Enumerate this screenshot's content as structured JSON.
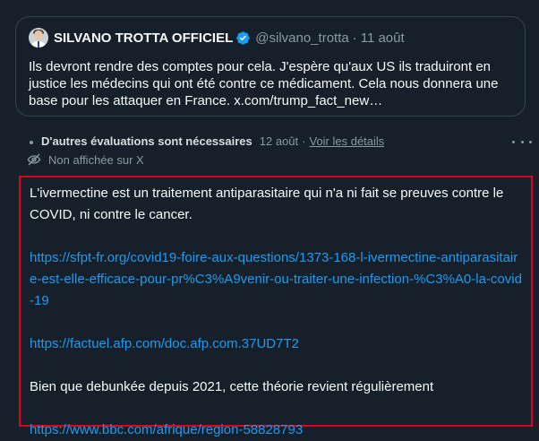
{
  "quoted_tweet": {
    "author_name": "SILVANO TROTTA OFFICIEL",
    "handle": "@silvano_trotta",
    "separator": "·",
    "date": "11 août",
    "text": "Ils devront rendre des comptes pour cela. J'espère qu'aux US ils traduiront en justice les médecins qui ont été contre ce médicament. Cela nous donnera une base pour les attaquer en France. x.com/trump_fact_new…",
    "verified_icon": "verified-badge-icon"
  },
  "community_note": {
    "rating_status": "D'autres évaluations sont nécessaires",
    "date": "12 août",
    "separator": "·",
    "details_link": "Voir les détails",
    "more_icon": "more-horizontal-icon",
    "visibility_status": "Non affichée sur X",
    "visibility_icon": "eye-off-icon",
    "body": {
      "intro": "L'ivermectine est un traitement antiparasitaire qui n'a ni fait se preuves contre le COVID, ni contre le cancer.",
      "link1": "https://sfpt-fr.org/covid19-foire-aux-questions/1373-168-l-ivermectine-antiparasitaire-est-elle-efficace-pour-pr%C3%A9venir-ou-traiter-une-infection-%C3%A0-la-covid-19",
      "link2": "https://factuel.afp.com/doc.afp.com.37UD7T2",
      "statement": "Bien que debunkée depuis 2021, cette théorie revient régulièrement",
      "link3": "https://www.bbc.com/afrique/region-58828793"
    }
  },
  "colors": {
    "background": "#15202b",
    "border": "#38444d",
    "link": "#1d9bf0",
    "highlight_frame": "#e0001b",
    "muted_text": "#8b98a5"
  }
}
